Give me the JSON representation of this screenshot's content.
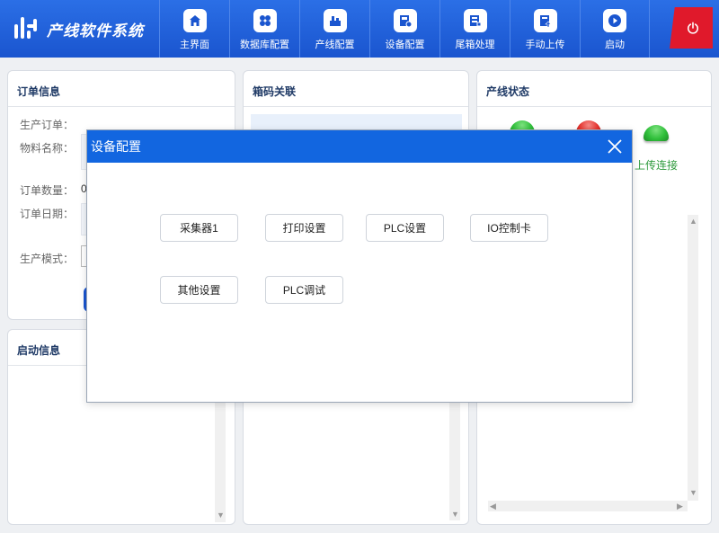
{
  "header": {
    "title": "产线软件系统",
    "logo_icon": "logo-icon",
    "nav": [
      {
        "id": "home",
        "label": "主界面",
        "icon": "home-icon"
      },
      {
        "id": "database",
        "label": "数据库配置",
        "icon": "database-icon"
      },
      {
        "id": "line",
        "label": "产线配置",
        "icon": "line-icon"
      },
      {
        "id": "device",
        "label": "设备配置",
        "icon": "device-icon"
      },
      {
        "id": "tailbox",
        "label": "尾箱处理",
        "icon": "tailbox-icon"
      },
      {
        "id": "upload",
        "label": "手动上传",
        "icon": "upload-icon"
      },
      {
        "id": "start",
        "label": "启动",
        "icon": "play-icon"
      }
    ],
    "power_icon": "power-icon"
  },
  "order_panel": {
    "title": "订单信息",
    "fields": {
      "order_label": "生产订单：",
      "material_label": "物料名称：",
      "qty_label": "订单数量：",
      "qty_value": "0",
      "date_label": "订单日期：",
      "mode_label": "生产模式："
    }
  },
  "startup_panel": {
    "title": "启动信息"
  },
  "box_panel": {
    "title": "箱码关联"
  },
  "status_panel": {
    "title": "产线状态",
    "upload_label": "上传连接",
    "lamps": [
      {
        "name": "status-lamp-1",
        "color": "#2fbf3a"
      },
      {
        "name": "status-lamp-2",
        "color": "#e5322d"
      },
      {
        "name": "status-lamp-3",
        "color": "#2fbf3a"
      }
    ]
  },
  "modal": {
    "title": "设备配置",
    "buttons": [
      {
        "id": "collector",
        "label": "采集器1"
      },
      {
        "id": "print",
        "label": "打印设置"
      },
      {
        "id": "plc",
        "label": "PLC设置"
      },
      {
        "id": "io",
        "label": "IO控制卡"
      },
      {
        "id": "other",
        "label": "其他设置"
      },
      {
        "id": "plcdebug",
        "label": "PLC调试"
      }
    ]
  },
  "colors": {
    "header_blue": "#1a55cf",
    "modal_blue": "#1266e0",
    "power_red": "#e0192b",
    "status_green": "#2e9a3c"
  }
}
